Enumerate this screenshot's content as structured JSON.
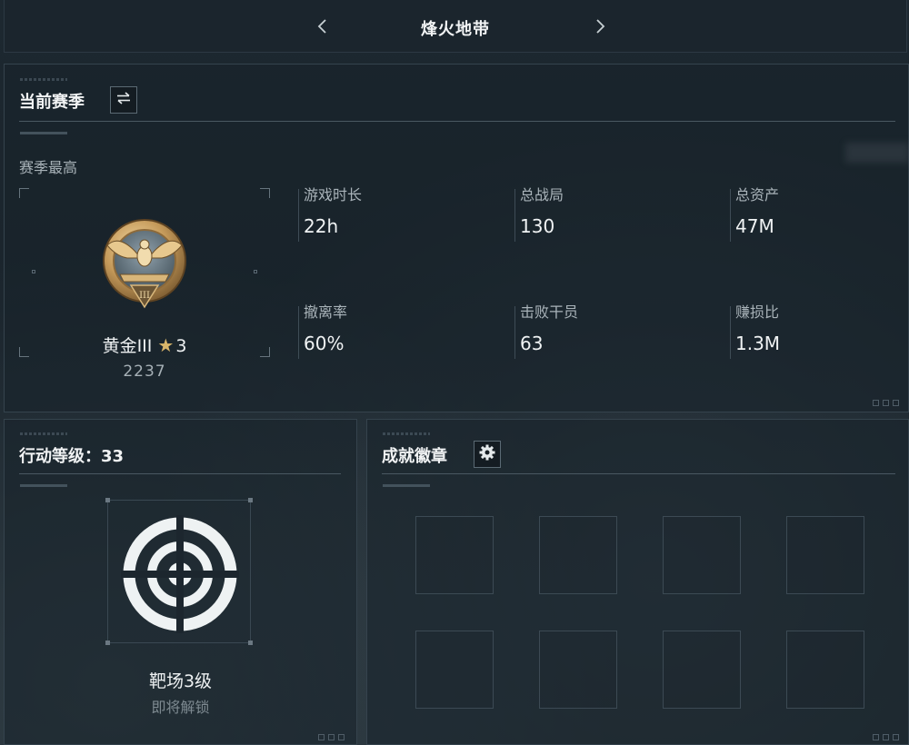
{
  "topbar": {
    "title": "烽火地带"
  },
  "season": {
    "heading": "当前赛季",
    "sub_label": "赛季最高",
    "rank": {
      "name": "黄金III",
      "stars": "3",
      "score": "2237"
    },
    "stats": [
      {
        "label": "游戏时长",
        "value": "22h"
      },
      {
        "label": "总战局",
        "value": "130"
      },
      {
        "label": "总资产",
        "value": "47M"
      },
      {
        "label": "撤离率",
        "value": "60%"
      },
      {
        "label": "击败干员",
        "value": "63"
      },
      {
        "label": "赚损比",
        "value": "1.3M"
      }
    ]
  },
  "action_level": {
    "heading": "行动等级：33",
    "name": "靶场3级",
    "status": "即将解锁"
  },
  "badges": {
    "heading": "成就徽章",
    "slots": [
      "",
      "",
      "",
      "",
      "",
      "",
      "",
      ""
    ]
  },
  "colors": {
    "background": "#1a232b",
    "panel_border": "#35434d",
    "text_primary": "#f0f3f4",
    "text_secondary": "#a9b3b9",
    "rank_gold": "#c9a05a"
  },
  "icons": {
    "prev": "chevron-left-icon",
    "next": "chevron-right-icon",
    "switch": "swap-arrows-icon",
    "settings": "gear-icon",
    "rank": "gold-eagle-rank-emblem-icon",
    "level": "target-reticle-icon",
    "star": "star-icon"
  }
}
